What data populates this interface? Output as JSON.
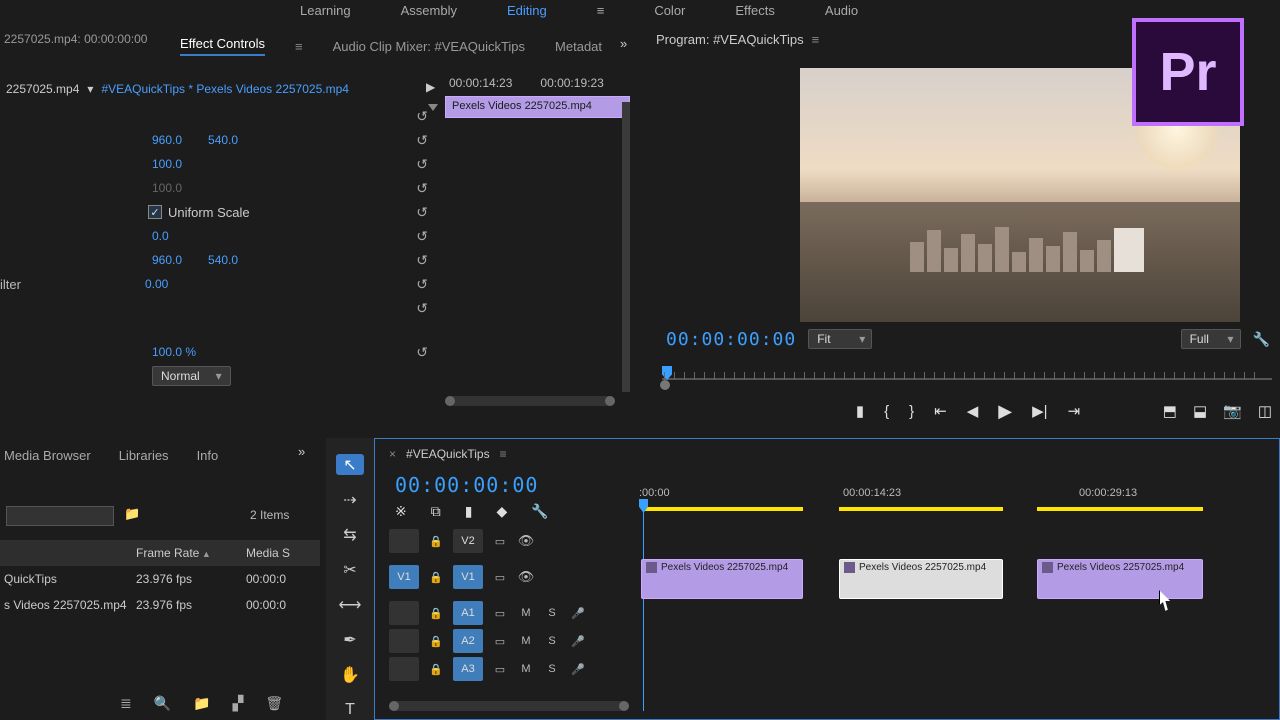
{
  "workspaces": {
    "learning": "Learning",
    "assembly": "Assembly",
    "editing": "Editing",
    "color": "Color",
    "effects": "Effects",
    "audio": "Audio"
  },
  "filestrip": "2257025.mp4: 00:00:00:00",
  "panel_tabs1": {
    "effect_controls": "Effect Controls",
    "audio_mixer": "Audio Clip Mixer: #VEAQuickTips",
    "metadata": "Metadat"
  },
  "master": {
    "src": "2257025.mp4",
    "sep": " * ",
    "seq": "#VEAQuickTips * Pexels Videos 2257025.mp4",
    "caret": "▾"
  },
  "ec": {
    "pos_x": "960.0",
    "pos_y": "540.0",
    "scale": "100.0",
    "scale_w": "100.0",
    "uniform": "Uniform Scale",
    "rotation": "0.0",
    "anchor_x": "960.0",
    "anchor_y": "540.0",
    "flicker": "0.00",
    "opacity": "100.0 %",
    "blend": "Normal",
    "filter_label": "ilter"
  },
  "ec_times": {
    "a": "00:00:14:23",
    "b": "00:00:19:23"
  },
  "ec_clip": "Pexels Videos 2257025.mp4",
  "program": {
    "tab": "Program: #VEAQuickTips",
    "tc": "00:00:00:00",
    "fit": "Fit",
    "full": "Full"
  },
  "pr": "Pr",
  "project_tabs": {
    "media": "Media Browser",
    "libraries": "Libraries",
    "info": "Info"
  },
  "project": {
    "count": "2 Items",
    "cols": {
      "name": "",
      "fps": "Frame Rate",
      "start": "Media S"
    },
    "rows": [
      {
        "name": "QuickTips",
        "fps": "23.976 fps",
        "start": "00:00:0"
      },
      {
        "name": "s Videos 2257025.mp4",
        "fps": "23.976 fps",
        "start": "00:00:0"
      }
    ]
  },
  "timeline": {
    "name": "#VEAQuickTips",
    "tc": "00:00:00:00",
    "ruler": [
      ":00:00",
      "00:00:14:23",
      "00:00:29:13"
    ],
    "tracks": {
      "v2": "V2",
      "v1": "V1",
      "v1src": "V1",
      "a1": "A1",
      "a2": "A2",
      "a3": "A3",
      "m": "M",
      "s": "S"
    },
    "clip": "Pexels Videos 2257025.mp4"
  }
}
